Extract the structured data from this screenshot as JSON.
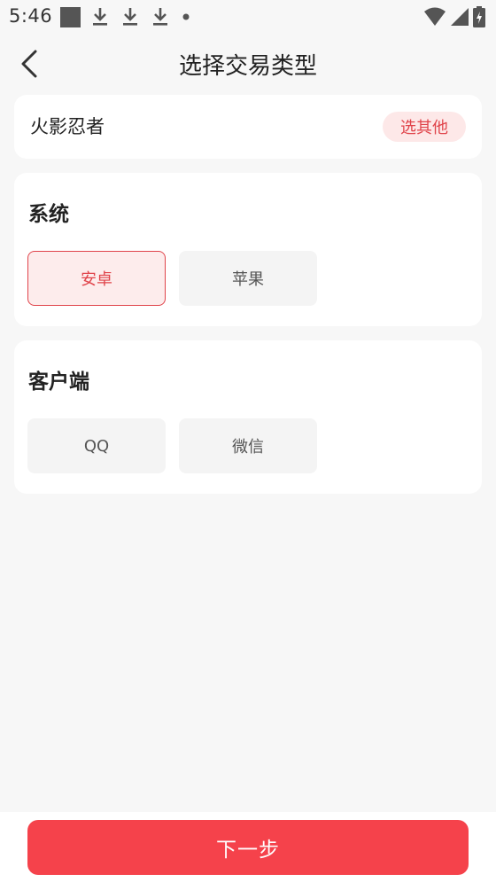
{
  "status_bar": {
    "time": "5:46",
    "left_icons": [
      "image-notification-icon",
      "download-icon",
      "download-icon",
      "download-icon",
      "dot-icon"
    ],
    "right_icons": [
      "wifi-icon",
      "signal-icon",
      "battery-icon"
    ]
  },
  "header": {
    "title": "选择交易类型"
  },
  "game": {
    "name": "火影忍者",
    "other_label": "选其他"
  },
  "system_section": {
    "title": "系统",
    "options": [
      {
        "label": "安卓",
        "selected": true
      },
      {
        "label": "苹果",
        "selected": false
      }
    ]
  },
  "client_section": {
    "title": "客户端",
    "options": [
      {
        "label": "QQ",
        "selected": false
      },
      {
        "label": "微信",
        "selected": false
      }
    ]
  },
  "footer": {
    "next_label": "下一步"
  },
  "colors": {
    "accent": "#f5424b",
    "accent_text": "#e0434a",
    "accent_bg": "#fdecec",
    "page_bg": "#f7f7f7"
  }
}
